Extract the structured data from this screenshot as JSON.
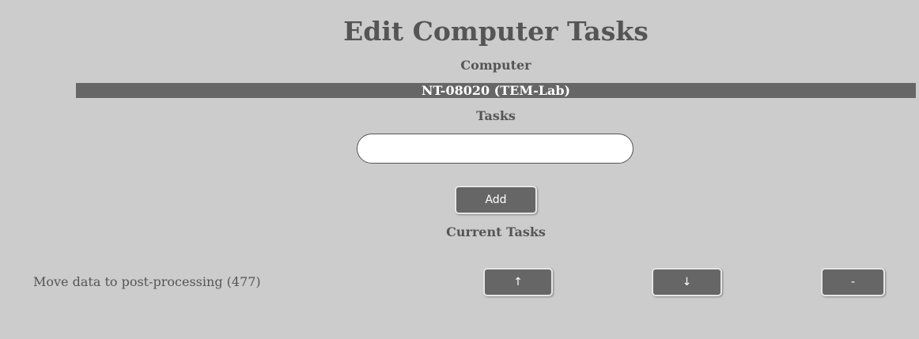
{
  "page": {
    "title": "Edit Computer Tasks"
  },
  "computer": {
    "label": "Computer",
    "name": "NT-08020 (TEM-Lab)"
  },
  "tasks": {
    "label": "Tasks",
    "input_value": "",
    "add_label": "Add"
  },
  "current_tasks": {
    "label": "Current Tasks",
    "items": [
      {
        "text": "Move data to post-processing (477)",
        "up_label": "↑",
        "down_label": "↓",
        "remove_label": "-"
      }
    ]
  },
  "colors": {
    "background": "#cccccc",
    "bar": "#666666",
    "button": "#666666",
    "text": "#555555"
  }
}
